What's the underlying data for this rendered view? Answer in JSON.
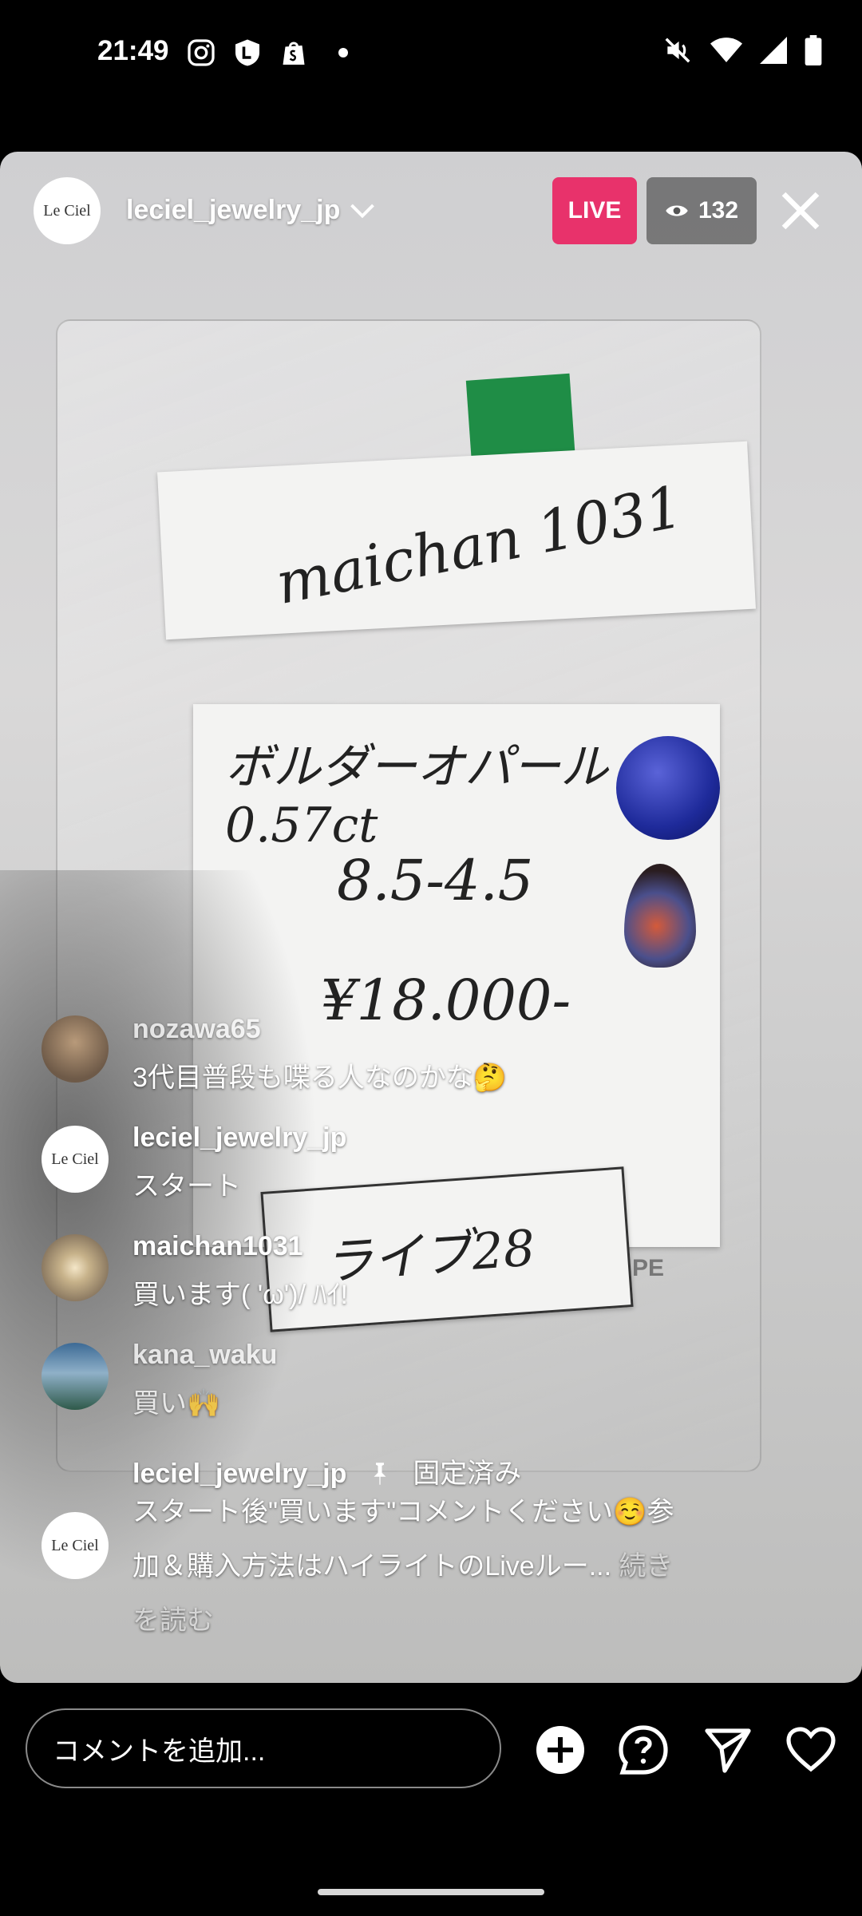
{
  "status_bar": {
    "time": "21:49",
    "left_icons": [
      "instagram-icon",
      "shield-l-icon",
      "shopify-bag-icon",
      "dot-icon"
    ],
    "right_icons": [
      "mute-icon",
      "wifi-icon",
      "signal-icon",
      "battery-icon"
    ]
  },
  "header": {
    "avatar_text": "Le Ciel",
    "username": "leciel_jewelry_jp",
    "live_label": "LIVE",
    "viewer_count": "132"
  },
  "stream": {
    "card_top_text": "maichan 1031",
    "card_line1": "ボルダーオパール 0.57ct",
    "card_line2": "8.5-4.5",
    "card_line3": "¥18.000-",
    "card_bottom_text": "ライブ28",
    "pe_text": "PE"
  },
  "comments": [
    {
      "user": "nozawa65",
      "text": "3代目普段も喋る人なのかな🤔",
      "avatar": "photo-avatar"
    },
    {
      "user": "leciel_jewelry_jp",
      "text": "スタート",
      "avatar": "Le Ciel"
    },
    {
      "user": "maichan1031",
      "text": "買います( 'ω')/ ﾊｲ!",
      "avatar": "ring-avatar"
    },
    {
      "user": "kana_waku",
      "text": "買い🙌",
      "avatar": "sky-avatar"
    }
  ],
  "pinned_comment": {
    "user": "leciel_jewelry_jp",
    "pinned_label": "固定済み",
    "line1": "スタート後\"買います\"コメントください☺️参",
    "line2": "加＆購入方法はハイライトのLiveルー...",
    "more_1": "続き",
    "more_2": "を読む",
    "avatar_text": "Le Ciel"
  },
  "bottom_bar": {
    "comment_placeholder": "コメントを追加...",
    "icons": [
      "add-icon",
      "question-icon",
      "send-icon",
      "heart-icon"
    ]
  }
}
